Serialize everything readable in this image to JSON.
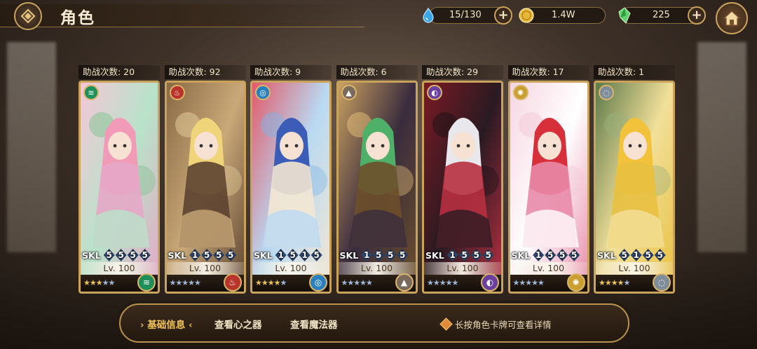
{
  "header": {
    "title": "角色",
    "stamina": "15/130",
    "gold": "1.4W",
    "gems": "225"
  },
  "cards": [
    {
      "assist_label": "助战次数: 20",
      "skills": [
        "5",
        "5",
        "5",
        "5"
      ],
      "level": "Lv. 100",
      "stars_gold": 3,
      "stars_blue": 2,
      "element": "wind",
      "element_color": "#1f8f5a",
      "palette": [
        "#f4c6d8",
        "#b8e3c9",
        "#e6a7c6",
        "#7fc48f"
      ],
      "hair": "#f29bb8"
    },
    {
      "assist_label": "助战次数: 92",
      "skills": [
        "1",
        "5",
        "5",
        "5"
      ],
      "level": "Lv. 100",
      "stars_gold": 0,
      "stars_blue": 5,
      "element": "fire",
      "element_color": "#b8342a",
      "palette": [
        "#8a6a45",
        "#c9a878",
        "#5c4330",
        "#e8d2a0"
      ],
      "hair": "#f0d47a"
    },
    {
      "assist_label": "助战次数: 9",
      "skills": [
        "1",
        "5",
        "1",
        "5"
      ],
      "level": "Lv. 100",
      "stars_gold": 4,
      "stars_blue": 1,
      "element": "water",
      "element_color": "#2a7fbf",
      "palette": [
        "#e25a6a",
        "#b9d9f2",
        "#f4e7d3",
        "#7fb3e6"
      ],
      "hair": "#3b5db8"
    },
    {
      "assist_label": "助战次数: 6",
      "skills": [
        "1",
        "5",
        "5",
        "5"
      ],
      "level": "Lv. 100",
      "stars_gold": 0,
      "stars_blue": 5,
      "element": "earth",
      "element_color": "#7a6a5c",
      "palette": [
        "#c9a060",
        "#3a2c3e",
        "#6b4f2a",
        "#e8c27a"
      ],
      "hair": "#4fb06a"
    },
    {
      "assist_label": "助战次数: 29",
      "skills": [
        "1",
        "5",
        "5",
        "5"
      ],
      "level": "Lv. 100",
      "stars_gold": 0,
      "stars_blue": 5,
      "element": "dark",
      "element_color": "#6a3fa0",
      "palette": [
        "#7a1a24",
        "#2a1a22",
        "#b83040",
        "#1a1218"
      ],
      "hair": "#e8e8ec"
    },
    {
      "assist_label": "助战次数: 17",
      "skills": [
        "1",
        "5",
        "5",
        "5"
      ],
      "level": "Lv. 100",
      "stars_gold": 0,
      "stars_blue": 5,
      "element": "light",
      "element_color": "#c9a030",
      "palette": [
        "#f6d6e2",
        "#ffffff",
        "#e88aa8",
        "#f2c8d6"
      ],
      "hair": "#d8303a"
    },
    {
      "assist_label": "助战次数: 1",
      "skills": [
        "5",
        "1",
        "5",
        "5"
      ],
      "level": "Lv. 100",
      "stars_gold": 4,
      "stars_blue": 1,
      "element": "neutral",
      "element_color": "#7f8c99",
      "palette": [
        "#5e7a4a",
        "#f2e09a",
        "#e8c040",
        "#9ab07a"
      ],
      "hair": "#f2c23a"
    }
  ],
  "card_text": {
    "skl_label": "SKL"
  },
  "tabs": [
    {
      "label": "基础信息",
      "active": true
    },
    {
      "label": "查看心之器",
      "active": false
    },
    {
      "label": "查看魔法器",
      "active": false
    }
  ],
  "tab_arrow_left": "›",
  "tab_arrow_right": "‹",
  "hint": "长按角色卡牌可查看详情",
  "icons": {
    "back": "diamond-back-icon",
    "stamina": "water-drop-icon",
    "gold": "gold-coin-icon",
    "gems": "green-crystal-icon",
    "home": "home-icon"
  }
}
